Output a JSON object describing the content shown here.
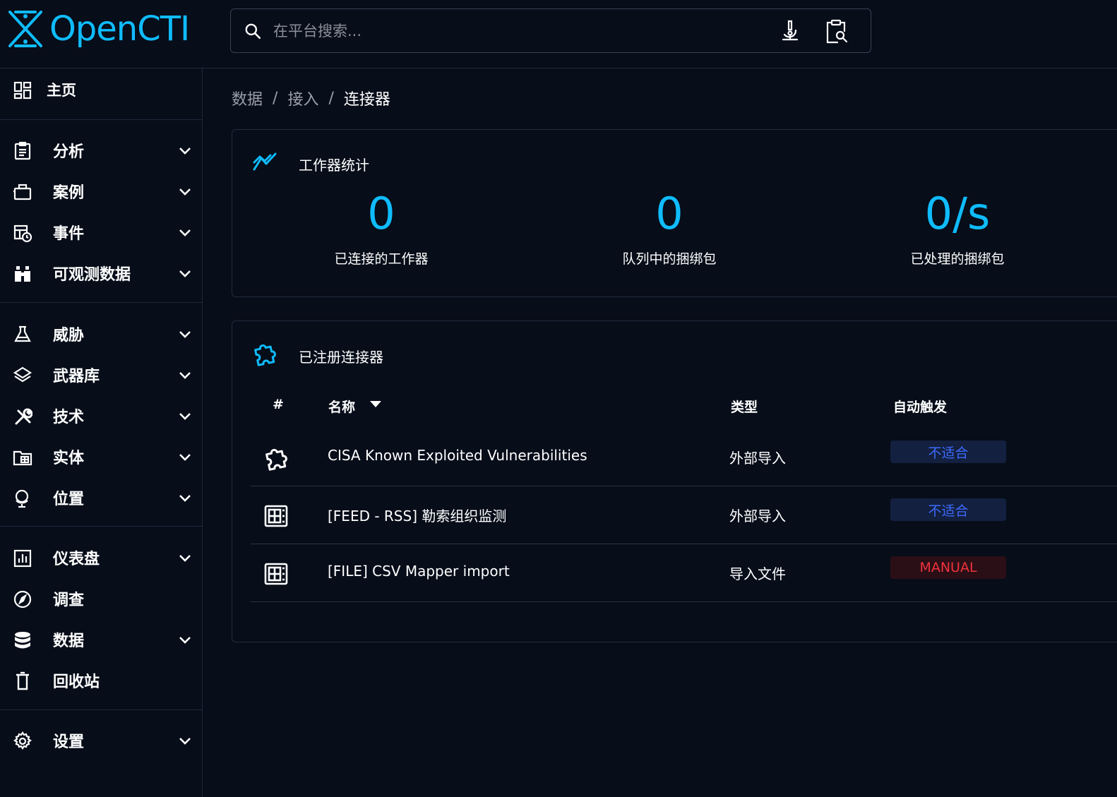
{
  "app": {
    "logo_text": "OpenCTI",
    "brand_color": "#0fbcff"
  },
  "search": {
    "placeholder": "在平台搜索..."
  },
  "sidebar": {
    "items": [
      {
        "label": "主页",
        "icon": "dashboard-grid-icon",
        "has_chevron": false
      },
      {
        "label": "分析",
        "icon": "clipboard-icon",
        "has_chevron": true
      },
      {
        "label": "案例",
        "icon": "briefcase-icon",
        "has_chevron": true
      },
      {
        "label": "事件",
        "icon": "calendar-clock-icon",
        "has_chevron": true
      },
      {
        "label": "可观测数据",
        "icon": "binoculars-icon",
        "has_chevron": true
      },
      {
        "label": "威胁",
        "icon": "flask-icon",
        "has_chevron": true
      },
      {
        "label": "武器库",
        "icon": "layers-icon",
        "has_chevron": true
      },
      {
        "label": "技术",
        "icon": "tools-icon",
        "has_chevron": true
      },
      {
        "label": "实体",
        "icon": "folder-table-icon",
        "has_chevron": true
      },
      {
        "label": "位置",
        "icon": "globe-icon",
        "has_chevron": true
      },
      {
        "label": "仪表盘",
        "icon": "chart-box-icon",
        "has_chevron": true
      },
      {
        "label": "调查",
        "icon": "compass-icon",
        "has_chevron": false
      },
      {
        "label": "数据",
        "icon": "database-icon",
        "has_chevron": true
      },
      {
        "label": "回收站",
        "icon": "trash-icon",
        "has_chevron": false
      },
      {
        "label": "设置",
        "icon": "gear-icon",
        "has_chevron": true
      }
    ]
  },
  "breadcrumb": [
    "数据",
    "接入",
    "连接器"
  ],
  "worker_stats": {
    "title": "工作器统计",
    "stats": [
      {
        "value": "0",
        "label": "已连接的工作器"
      },
      {
        "value": "0",
        "label": "队列中的捆绑包"
      },
      {
        "value": "0/s",
        "label": "已处理的捆绑包"
      }
    ]
  },
  "connectors": {
    "title": "已注册连接器",
    "columns": {
      "index": "#",
      "name": "名称",
      "type": "类型",
      "auto": "自动触发"
    },
    "rows": [
      {
        "icon": "puzzle-icon",
        "name": "CISA Known Exploited Vulnerabilities",
        "type": "外部导入",
        "auto": "不适合",
        "auto_kind": "na"
      },
      {
        "icon": "feed-icon",
        "name": "[FEED - RSS] 勒索组织监测",
        "type": "外部导入",
        "auto": "不适合",
        "auto_kind": "na"
      },
      {
        "icon": "feed-icon",
        "name": "[FILE] CSV Mapper import",
        "type": "导入文件",
        "auto": "MANUAL",
        "auto_kind": "manual"
      }
    ]
  }
}
